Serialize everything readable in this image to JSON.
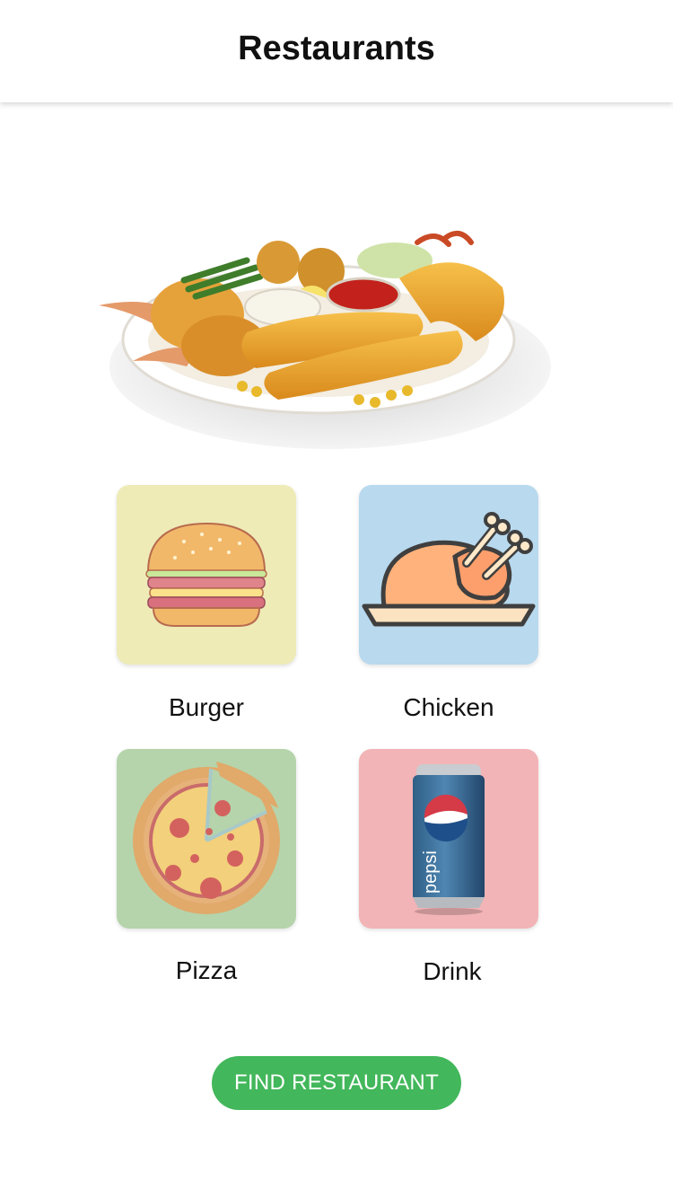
{
  "header": {
    "title": "Restaurants"
  },
  "hero": {
    "image": "fried-seafood-platter"
  },
  "categories": [
    {
      "label": "Burger",
      "icon": "burger-icon",
      "tile_color": "#eeebb7"
    },
    {
      "label": "Chicken",
      "icon": "roast-chicken-icon",
      "tile_color": "#b8d9ee"
    },
    {
      "label": "Pizza",
      "icon": "pizza-icon",
      "tile_color": "#b5d4ab"
    },
    {
      "label": "Drink",
      "icon": "soda-can-icon",
      "tile_color": "#f2b4b6",
      "can_text": "pepsi"
    }
  ],
  "actions": {
    "find_label": "FIND RESTAURANT",
    "button_color": "#43b75b"
  }
}
